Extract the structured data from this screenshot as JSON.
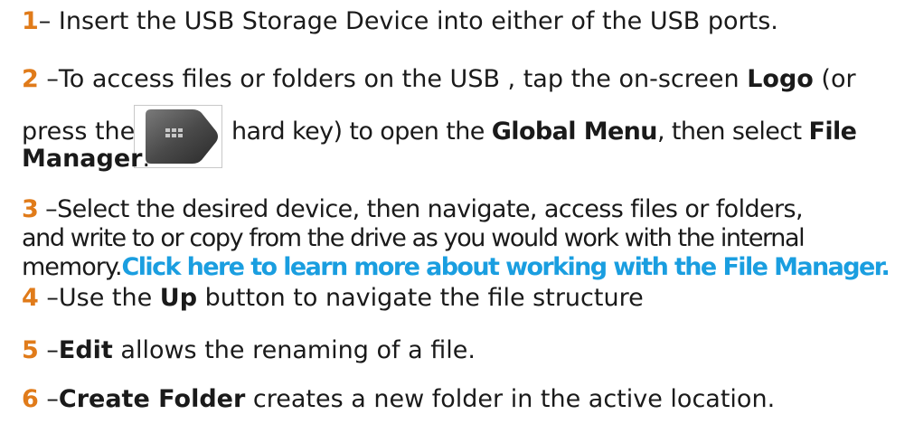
{
  "steps": [
    {
      "num": "1",
      "parts": [
        "– Insert the USB Storage Device into either of the USB ports."
      ]
    },
    {
      "num": "2",
      "a": " –To access files or folders on the USB , tap the on-screen ",
      "b": "Logo",
      "c": " (or",
      "d": "press the",
      "e": "hard key) to open the ",
      "f": "Global Menu",
      "g": ", then select ",
      "h": "File",
      "i": "Manager",
      "j": "."
    },
    {
      "num": "3",
      "a": " –Select the desired device, then navigate, access files or folders,",
      "b": "and write to or copy from the drive as you would work with the internal",
      "c": "memory.",
      "link": "Click here to learn more about working with the File Manager."
    },
    {
      "num": "4",
      "a": " –Use the ",
      "b": "Up",
      "c": " button to navigate the file structure"
    },
    {
      "num": "5",
      "a": " –",
      "b": "Edit",
      "c": " allows the renaming of a file."
    },
    {
      "num": "6",
      "a": " –",
      "b": "Create Folder",
      "c": " creates a new folder in the active location."
    }
  ],
  "icon": "global-menu-hard-key-icon",
  "colors": {
    "step_number": "#e07b1a",
    "link": "#1a9ee0",
    "text": "#1a1a1a"
  }
}
